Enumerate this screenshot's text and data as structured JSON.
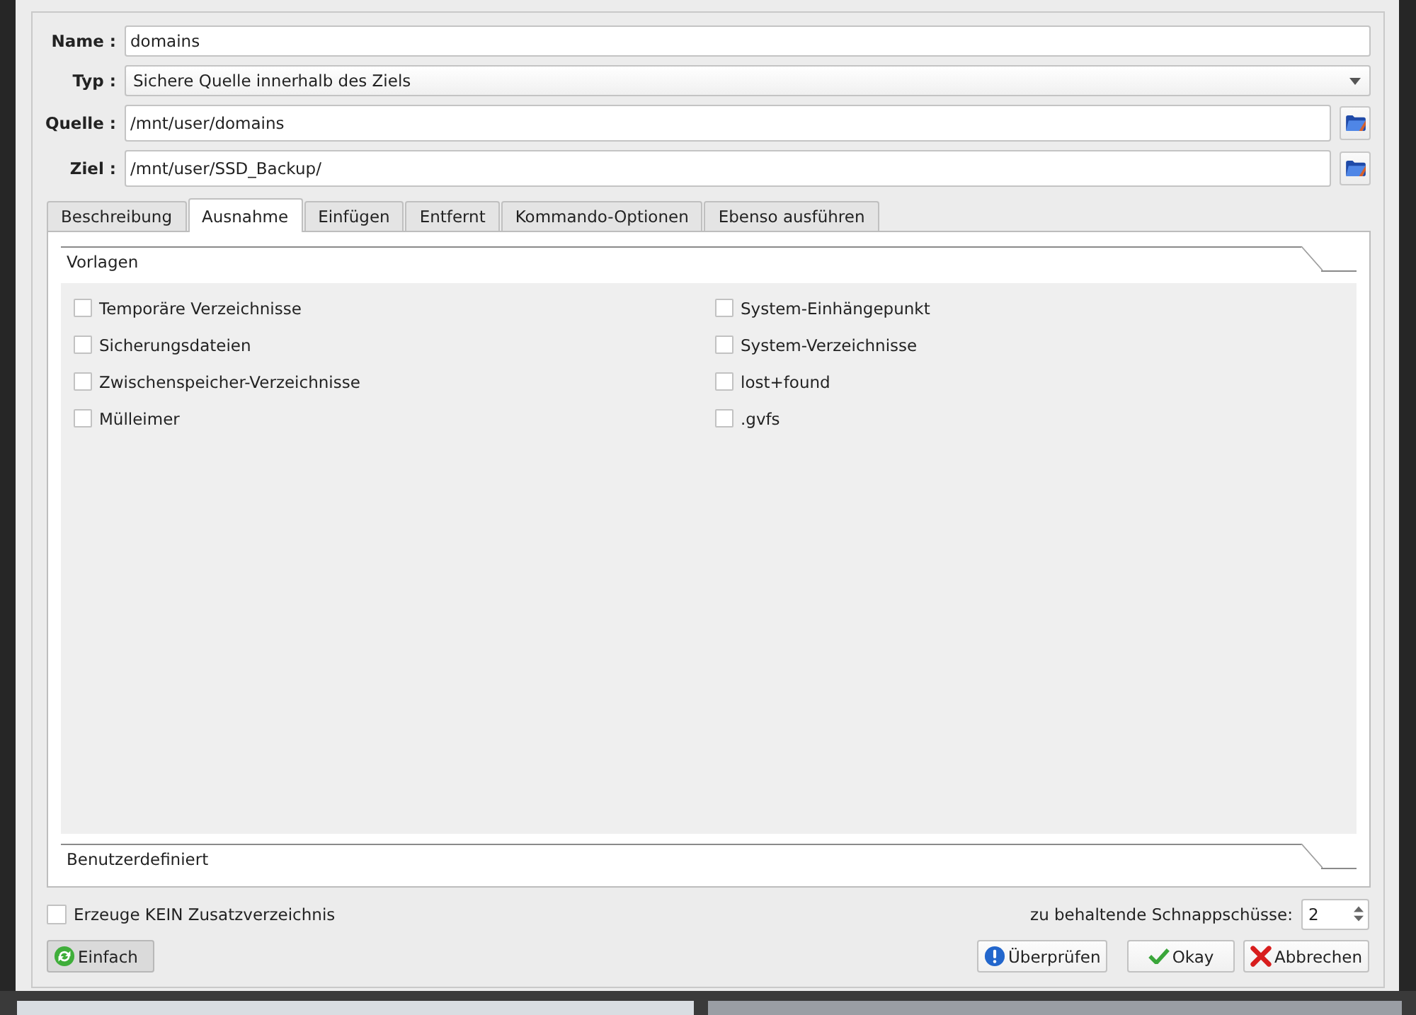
{
  "form": {
    "fields": [
      {
        "label": "Name :",
        "kind": "text",
        "value": "domains"
      },
      {
        "label": "Typ :",
        "kind": "combo",
        "value": "Sichere Quelle innerhalb des Ziels"
      },
      {
        "label": "Quelle :",
        "kind": "path",
        "value": "/mnt/user/domains"
      },
      {
        "label": "Ziel :",
        "kind": "path",
        "value": "/mnt/user/SSD_Backup/"
      }
    ]
  },
  "tabs": [
    {
      "label": "Beschreibung",
      "selected": false
    },
    {
      "label": "Ausnahme",
      "selected": true
    },
    {
      "label": "Einfügen",
      "selected": false
    },
    {
      "label": "Entfernt",
      "selected": false
    },
    {
      "label": "Kommando-Optionen",
      "selected": false
    },
    {
      "label": "Ebenso ausführen",
      "selected": false
    }
  ],
  "sections": [
    {
      "title": "Vorlagen",
      "expanded": true,
      "columns": [
        [
          {
            "label": "Temporäre Verzeichnisse",
            "checked": false
          },
          {
            "label": "Sicherungsdateien",
            "checked": false
          },
          {
            "label": "Zwischenspeicher-Verzeichnisse",
            "checked": false
          },
          {
            "label": "Mülleimer",
            "checked": false
          }
        ],
        [
          {
            "label": "System-Einhängepunkt",
            "checked": false
          },
          {
            "label": "System-Verzeichnisse",
            "checked": false
          },
          {
            "label": "lost+found",
            "checked": false
          },
          {
            "label": ".gvfs",
            "checked": false
          }
        ]
      ]
    },
    {
      "title": "Benutzerdefiniert",
      "expanded": false
    }
  ],
  "no_extra_dir": {
    "label": "Erzeuge KEIN Zusatzverzeichnis",
    "checked": false
  },
  "snapshots": {
    "label": "zu behaltende Schnappschüsse:",
    "value": "2"
  },
  "buttons": [
    {
      "label": "Einfach",
      "kind": "simple",
      "pressed": true
    },
    {
      "label": "Überprüfen",
      "kind": "validate",
      "pressed": false
    },
    {
      "label": "Okay",
      "kind": "okay",
      "pressed": false
    },
    {
      "label": "Abbrechen",
      "kind": "cancel",
      "pressed": false
    }
  ]
}
